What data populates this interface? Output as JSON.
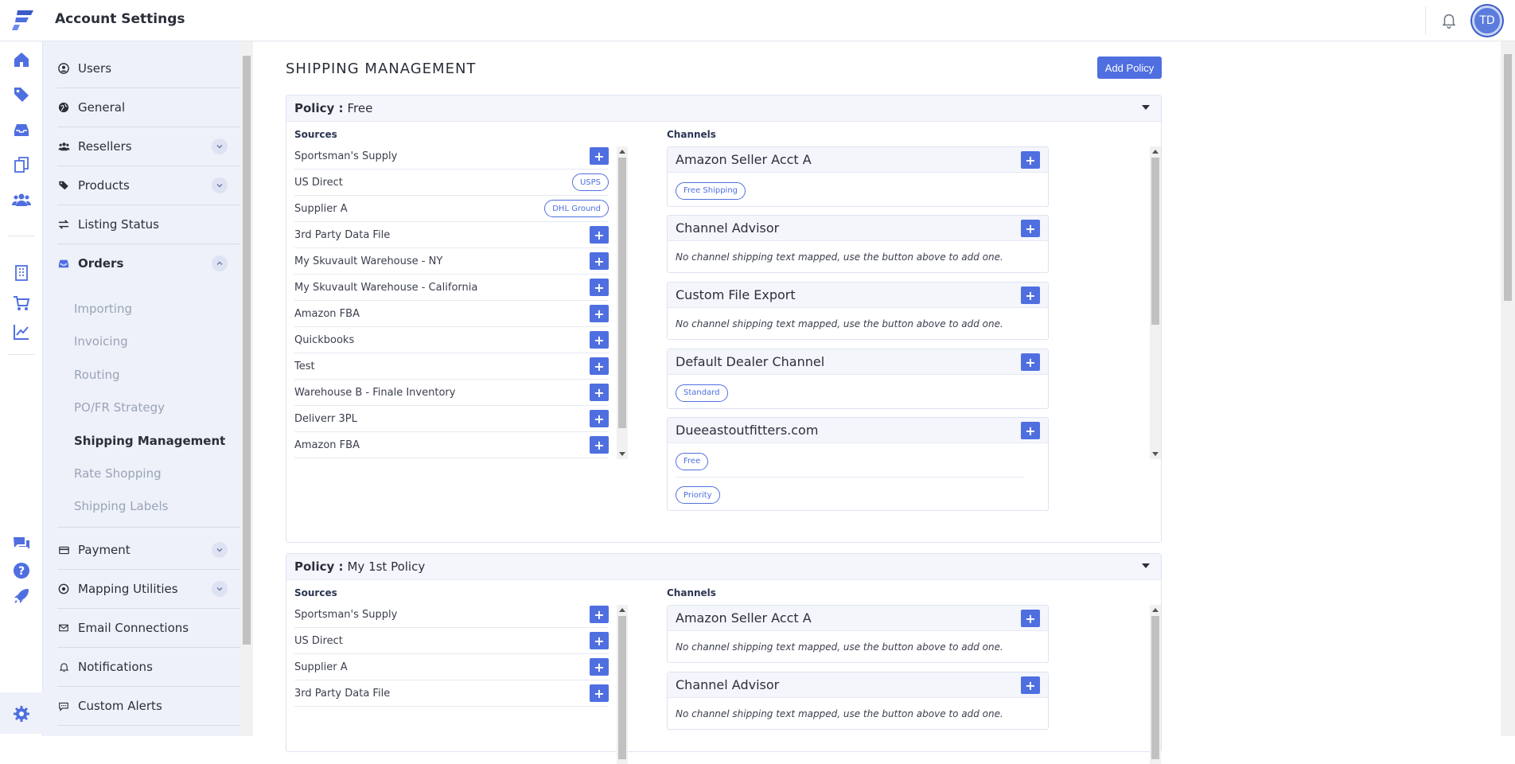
{
  "header": {
    "title": "Account Settings",
    "avatar_initials": "TD"
  },
  "colors": {
    "accent": "#4f6fe0",
    "nav_bg": "#eef1f9"
  },
  "rail": {
    "icons": [
      "home-icon",
      "tag-icon",
      "inbox-icon",
      "documents-icon",
      "users-icon",
      "building-icon",
      "cart-icon",
      "chart-line-icon",
      "chat-icon",
      "help-icon",
      "rocket-icon",
      "gear-icon"
    ]
  },
  "nav": {
    "items": [
      {
        "label": "Users",
        "icon": "user-circle-icon"
      },
      {
        "label": "General",
        "icon": "globe-icon"
      },
      {
        "label": "Resellers",
        "icon": "users-icon"
      },
      {
        "label": "Products",
        "icon": "tags-icon"
      },
      {
        "label": "Listing Status",
        "icon": "exchange-icon"
      },
      {
        "label": "Orders",
        "icon": "inbox-icon"
      }
    ],
    "orders_sub": [
      "Importing",
      "Invoicing",
      "Routing",
      "PO/FR Strategy",
      "Shipping Management",
      "Rate Shopping",
      "Shipping Labels"
    ],
    "items_after": [
      {
        "label": "Payment",
        "icon": "credit-card-icon"
      },
      {
        "label": "Mapping Utilities",
        "icon": "compass-icon"
      },
      {
        "label": "Email Connections",
        "icon": "envelope-icon"
      },
      {
        "label": "Notifications",
        "icon": "bell-icon"
      },
      {
        "label": "Custom Alerts",
        "icon": "comment-icon"
      }
    ]
  },
  "main": {
    "title": "SHIPPING MANAGEMENT",
    "add_policy_label": "Add Policy",
    "sources_label": "Sources",
    "channels_label": "Channels",
    "empty_text": "No channel shipping text mapped, use the button above to add one.",
    "policy_prefix": "Policy :",
    "policies": [
      {
        "name": "Free",
        "sources": [
          {
            "name": "Sportsman's Supply",
            "pill": null
          },
          {
            "name": "US Direct",
            "pill": "USPS"
          },
          {
            "name": "Supplier A",
            "pill": "DHL Ground"
          },
          {
            "name": "3rd Party Data File",
            "pill": null
          },
          {
            "name": "My Skuvault Warehouse - NY",
            "pill": null
          },
          {
            "name": "My Skuvault Warehouse - California",
            "pill": null
          },
          {
            "name": "Amazon FBA",
            "pill": null
          },
          {
            "name": "Quickbooks",
            "pill": null
          },
          {
            "name": "Test",
            "pill": null
          },
          {
            "name": "Warehouse B - Finale Inventory",
            "pill": null
          },
          {
            "name": "Deliverr 3PL",
            "pill": null
          },
          {
            "name": "Amazon FBA",
            "pill": null
          }
        ],
        "channels": [
          {
            "name": "Amazon Seller Acct A",
            "pills": [
              "Free Shipping"
            ]
          },
          {
            "name": "Channel Advisor",
            "pills": []
          },
          {
            "name": "Custom File Export",
            "pills": []
          },
          {
            "name": "Default Dealer Channel",
            "pills": [
              "Standard"
            ]
          },
          {
            "name": "Dueeastoutfitters.com",
            "pills": [
              "Free",
              "Priority"
            ]
          }
        ]
      },
      {
        "name": "My 1st Policy",
        "sources": [
          {
            "name": "Sportsman's Supply",
            "pill": null
          },
          {
            "name": "US Direct",
            "pill": null
          },
          {
            "name": "Supplier A",
            "pill": null
          },
          {
            "name": "3rd Party Data File",
            "pill": null
          }
        ],
        "channels": [
          {
            "name": "Amazon Seller Acct A",
            "pills": []
          },
          {
            "name": "Channel Advisor",
            "pills": []
          }
        ]
      }
    ]
  }
}
